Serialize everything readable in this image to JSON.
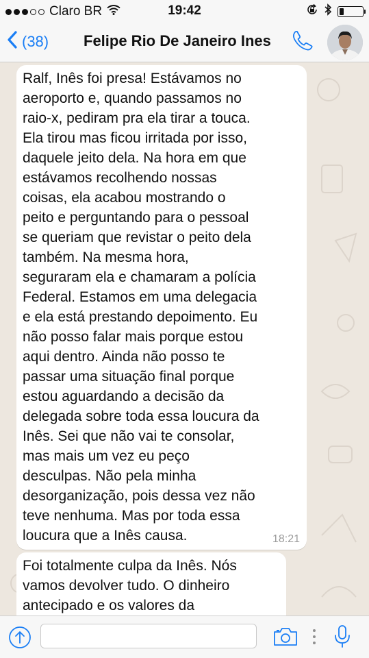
{
  "status_bar": {
    "carrier": "Claro BR",
    "time": "19:42",
    "signal_filled": 3,
    "signal_total": 5,
    "battery_level_fraction": 0.18
  },
  "header": {
    "back_count": "(38)",
    "contact_name": "Felipe Rio De Janeiro Ines"
  },
  "messages": [
    {
      "lines": [
        "Ralf, Inês foi presa! Estávamos no",
        "aeroporto e, quando passamos no",
        "raio-x, pediram pra ela tirar a touca.",
        "Ela tirou mas ficou irritada por isso,",
        "daquele jeito dela. Na hora em que",
        "estávamos recolhendo nossas",
        "coisas, ela acabou mostrando o",
        "peito e perguntando para o pessoal",
        "se queriam que revistar o peito dela",
        "também. Na mesma hora,",
        "seguraram ela e chamaram a polícia",
        "Federal. Estamos em uma delegacia",
        "e ela está prestando depoimento. Eu",
        "não posso falar mais porque estou",
        "aqui dentro. Ainda não posso te",
        "passar uma situação final porque",
        "estou aguardando a decisão da",
        "delegada sobre toda essa loucura da",
        "Inês. Sei que não vai te consolar,",
        "mas mais um vez eu peço",
        "desculpas. Não pela minha",
        "desorganização, pois dessa vez não",
        "teve nenhuma. Mas por toda essa",
        "loucura que a Inês causa."
      ],
      "time": "18:21"
    },
    {
      "lines": [
        "Foi totalmente culpa da Inês. Nós",
        "vamos devolver tudo. O dinheiro",
        "antecipado e os valores da"
      ],
      "time": ""
    }
  ],
  "input": {
    "value": "",
    "placeholder": ""
  },
  "colors": {
    "accent": "#1a7ef5",
    "bar_bg": "#f7f7f7",
    "chat_bg": "#ede7df",
    "bubble_bg": "#ffffff",
    "timestamp": "#9a9a9a"
  },
  "icons": [
    "wifi-icon",
    "lock-rotation-icon",
    "bluetooth-icon",
    "battery-icon",
    "back-chevron-icon",
    "phone-icon",
    "upload-icon",
    "camera-icon",
    "more-icon",
    "microphone-icon"
  ]
}
